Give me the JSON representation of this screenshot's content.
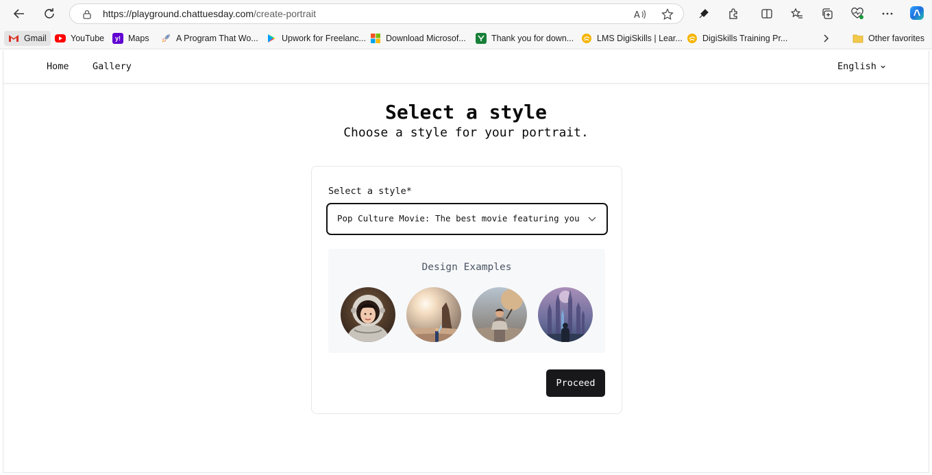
{
  "browser": {
    "url_host": "https://playground.chattuesday.com",
    "url_path": "/create-portrait",
    "bookmarks": [
      {
        "label": "Gmail",
        "icon": "gmail-icon"
      },
      {
        "label": "YouTube",
        "icon": "youtube-icon"
      },
      {
        "label": "Maps",
        "icon": "yahoo-maps-icon"
      },
      {
        "label": "A Program That Wo...",
        "icon": "rocket-icon"
      },
      {
        "label": "Upwork for Freelanc...",
        "icon": "google-play-icon"
      },
      {
        "label": "Download Microsof...",
        "icon": "microsoft-icon"
      },
      {
        "label": "Thank you for down...",
        "icon": "green-bookmark-icon"
      },
      {
        "label": "LMS DigiSkills | Lear...",
        "icon": "digiskills-icon"
      },
      {
        "label": "DigiSkills Training Pr...",
        "icon": "digiskills-icon"
      }
    ],
    "other_favorites": "Other favorites"
  },
  "site_nav": {
    "home": "Home",
    "gallery": "Gallery",
    "language": "English"
  },
  "header": {
    "title": "Select a style",
    "subtitle": "Choose a style for your portrait."
  },
  "form": {
    "style_label": "Select a style*",
    "style_value": "Pop Culture Movie: The best movie featuring you"
  },
  "examples": {
    "title": "Design Examples"
  },
  "actions": {
    "proceed": "Proceed"
  },
  "colors": {
    "button_bg": "#18181b",
    "panel_bg": "#f7f8fa",
    "border": "#e5e7eb"
  }
}
